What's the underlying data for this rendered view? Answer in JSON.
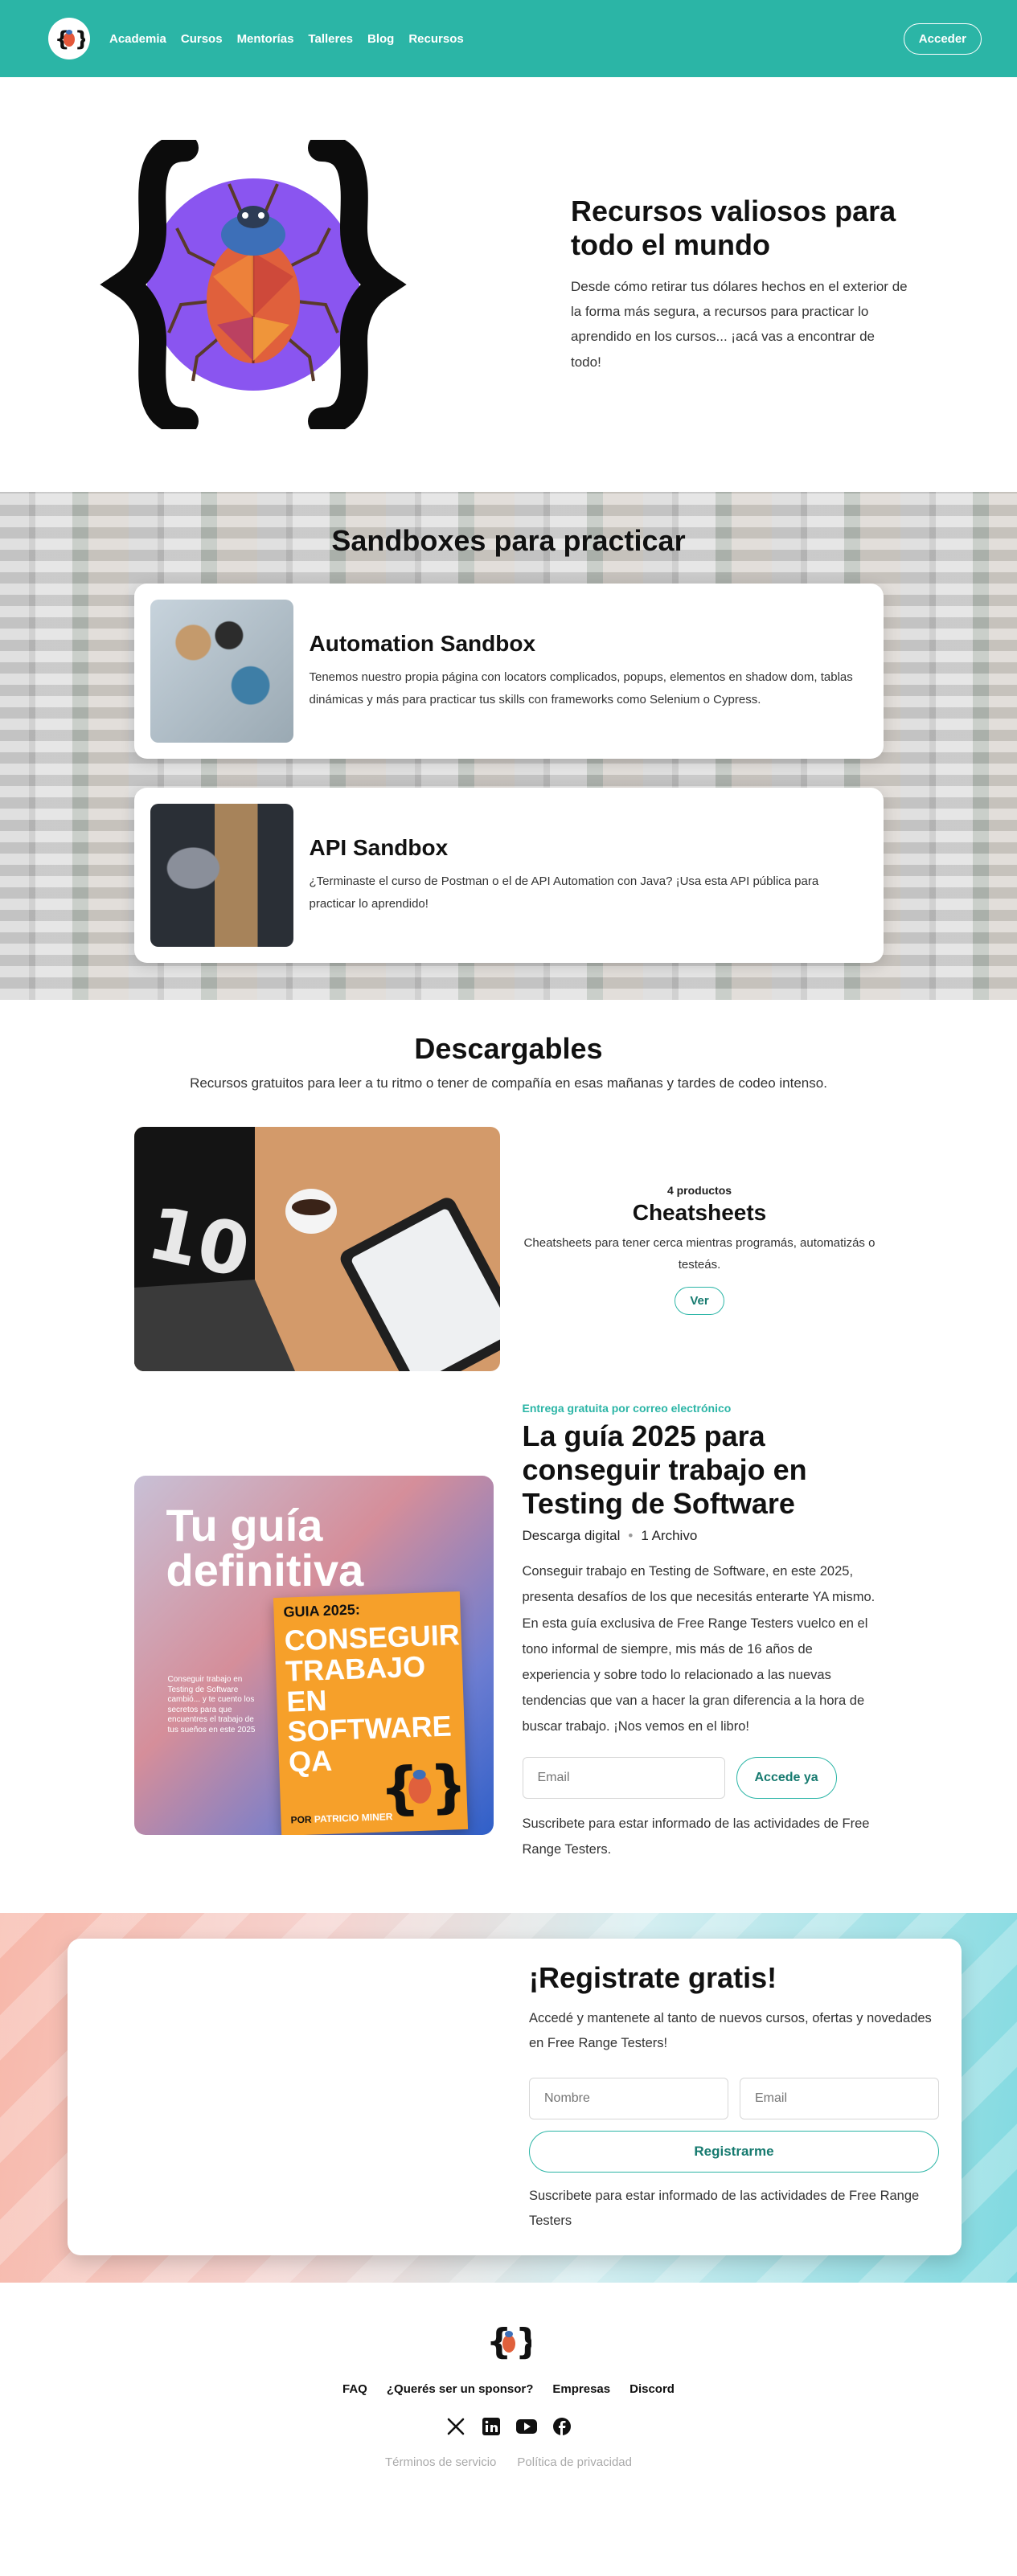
{
  "colors": {
    "brand": "#2bb5a6",
    "brand_dark": "#167a6f",
    "bug_purple": "#8a55f0"
  },
  "header": {
    "nav": [
      "Academia",
      "Cursos",
      "Mentorías",
      "Talleres",
      "Blog",
      "Recursos"
    ],
    "login_label": "Acceder"
  },
  "hero": {
    "title": "Recursos valiosos para todo el mundo",
    "description": "Desde cómo retirar tus dólares hechos en el exterior de la forma más segura, a recursos para practicar lo aprendido en los cursos... ¡acá vas a encontrar de todo!"
  },
  "sandboxes": {
    "title": "Sandboxes para practicar",
    "items": [
      {
        "title": "Automation Sandbox",
        "description": "Tenemos nuestro propia página con locators complicados, popups, elementos en shadow dom, tablas dinámicas y más para practicar tus skills con frameworks como Selenium o Cypress."
      },
      {
        "title": "API Sandbox",
        "description": "¿Terminaste el curso de Postman o el de API Automation con Java? ¡Usa esta API pública para practicar lo aprendido!"
      }
    ]
  },
  "downloads": {
    "title": "Descargables",
    "subtitle": "Recursos gratuitos para leer a tu ritmo o tener de compañía en esas mañanas y tardes de codeo intenso.",
    "product": {
      "count": "4 productos",
      "title": "Cheatsheets",
      "description": "Cheatsheets para tener cerca mientras programás, automatizás o testeás.",
      "button": "Ver",
      "image_text": "10"
    }
  },
  "guide": {
    "eyebrow": "Entrega gratuita por correo electrónico",
    "title": "La guía 2025 para conseguir trabajo en Testing de Software",
    "meta_type": "Descarga digital",
    "meta_files": "1 Archivo",
    "description": "Conseguir trabajo en Testing de Software, en este 2025, presenta desafíos de los que necesitás enterarte YA mismo. En esta guía exclusiva de Free Range Testers vuelco en el tono informal de siempre, mis más de 16 años de experiencia y sobre todo lo relacionado a las nuevas tendencias que van a hacer la gran diferencia a la hora de buscar trabajo. ¡Nos vemos en el libro!",
    "email_placeholder": "Email",
    "button": "Accede ya",
    "note": "Suscribete para estar informado de las actividades de Free Range Testers.",
    "cover": {
      "headline": "Tu guía definitiva",
      "small_text": "Conseguir trabajo en Testing de Software cambió... y te cuento los secretos para que encuentres el trabajo de tus sueños en este 2025",
      "book_label": "GUIA 2025:",
      "book_title": "CONSEGUIR TRABAJO EN SOFTWARE QA",
      "by": "POR",
      "author": "PATRICIO MINER"
    }
  },
  "register": {
    "title": "¡Registrate gratis!",
    "description": "Accedé y mantenete al tanto de nuevos cursos, ofertas y novedades en Free Range Testers!",
    "name_placeholder": "Nombre",
    "email_placeholder": "Email",
    "button": "Registrarme",
    "note": "Suscribete para estar informado de las actividades de Free Range Testers"
  },
  "footer": {
    "links": [
      "FAQ",
      "¿Querés ser un sponsor?",
      "Empresas",
      "Discord"
    ],
    "socials": [
      "x-icon",
      "linkedin-icon",
      "youtube-icon",
      "facebook-icon"
    ],
    "legal": [
      "Términos de servicio",
      "Política de privacidad"
    ]
  }
}
